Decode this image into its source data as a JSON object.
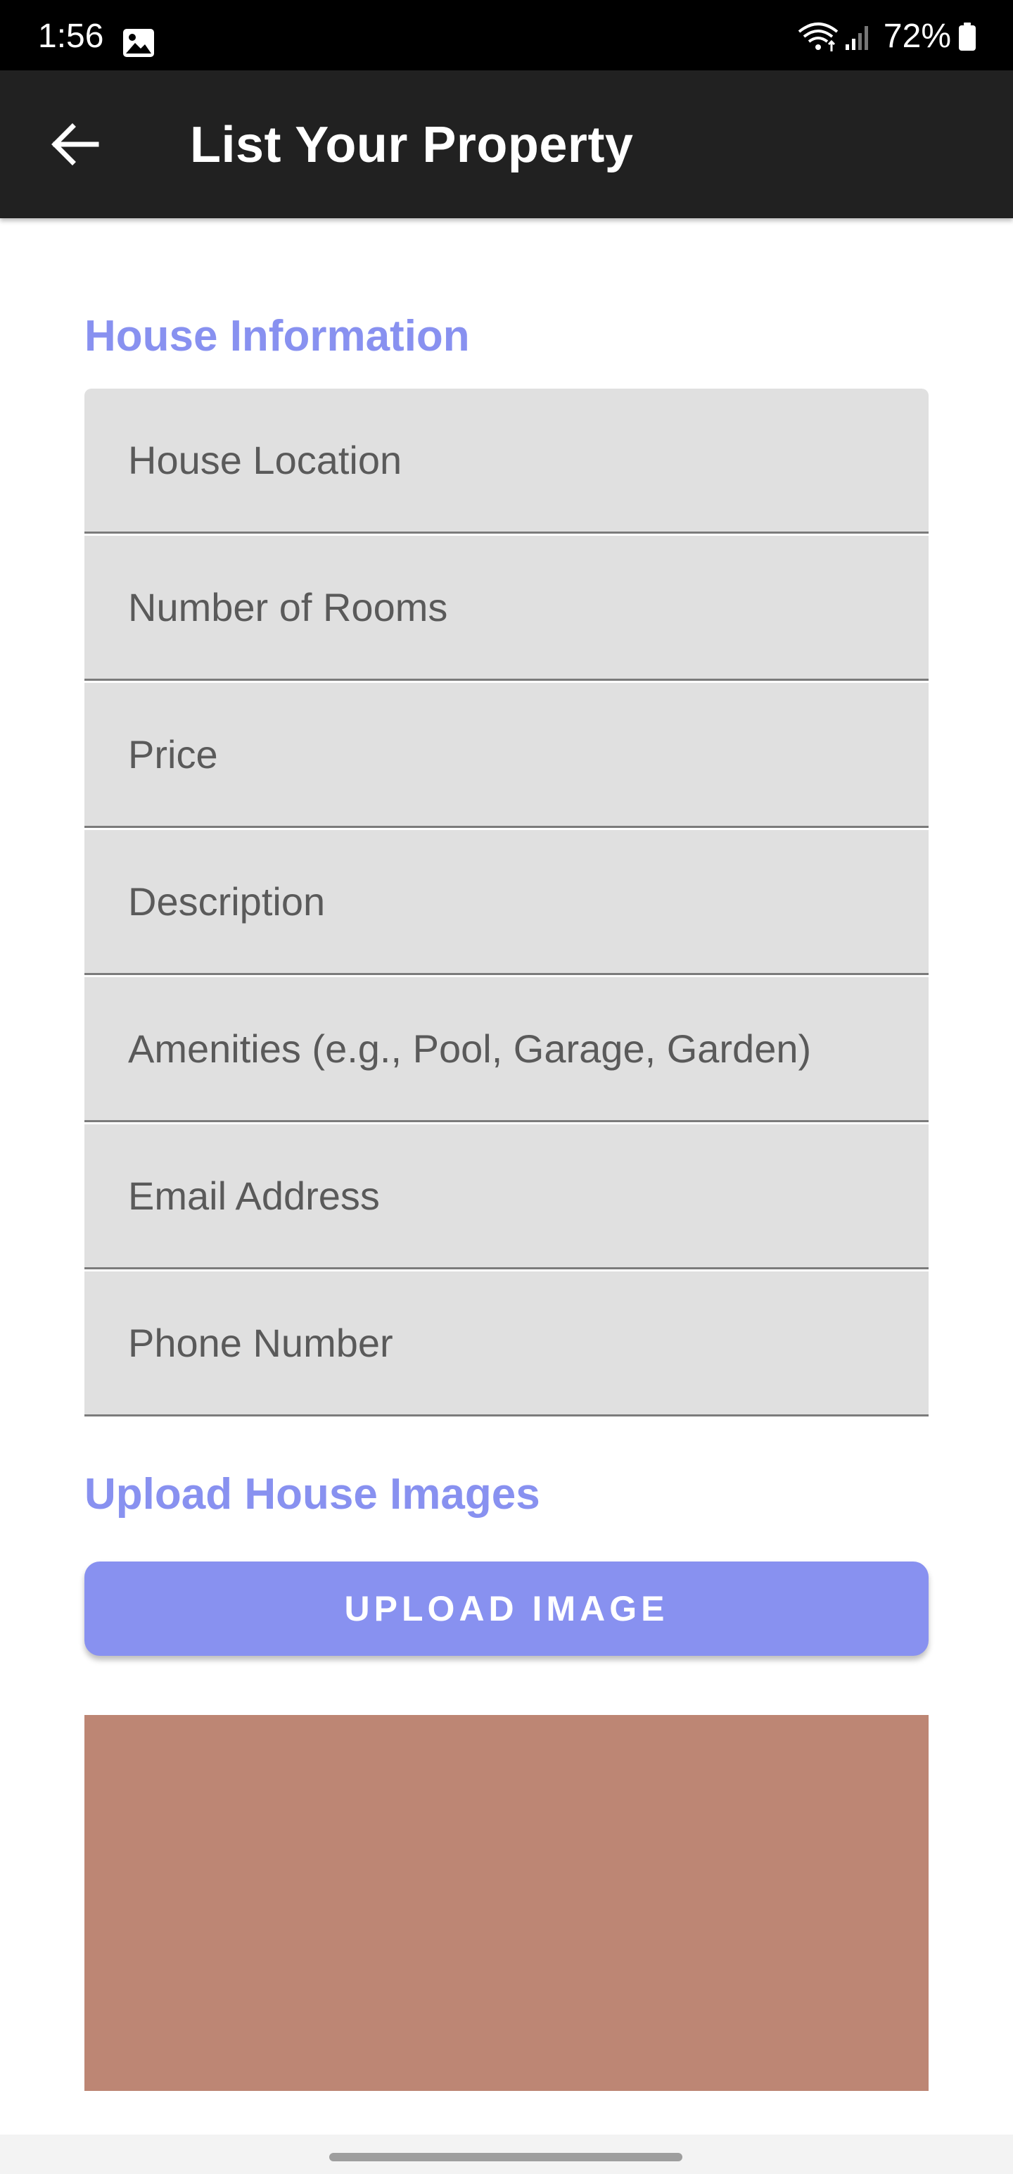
{
  "status_bar": {
    "time": "1:56",
    "battery": "72%",
    "icons": [
      "image-icon",
      "wifi-icon",
      "signal-icon",
      "battery-icon"
    ]
  },
  "app_bar": {
    "title": "List Your Property",
    "back_icon": "arrow-back-icon"
  },
  "house_information": {
    "heading": "House Information",
    "fields": {
      "location": {
        "placeholder": "House Location",
        "value": ""
      },
      "rooms": {
        "placeholder": "Number of Rooms",
        "value": ""
      },
      "price": {
        "placeholder": "Price",
        "value": ""
      },
      "description": {
        "placeholder": "Description",
        "value": ""
      },
      "amenities": {
        "placeholder": "Amenities (e.g., Pool, Garage, Garden)",
        "value": ""
      },
      "email": {
        "placeholder": "Email Address",
        "value": ""
      },
      "phone": {
        "placeholder": "Phone Number",
        "value": ""
      }
    }
  },
  "upload": {
    "heading": "Upload House Images",
    "button_label": "UPLOAD IMAGE"
  },
  "colors": {
    "accent": "#8891f0",
    "app_bar": "#212121",
    "field_background": "#e0e0e0",
    "image_preview": "#bd8674"
  }
}
